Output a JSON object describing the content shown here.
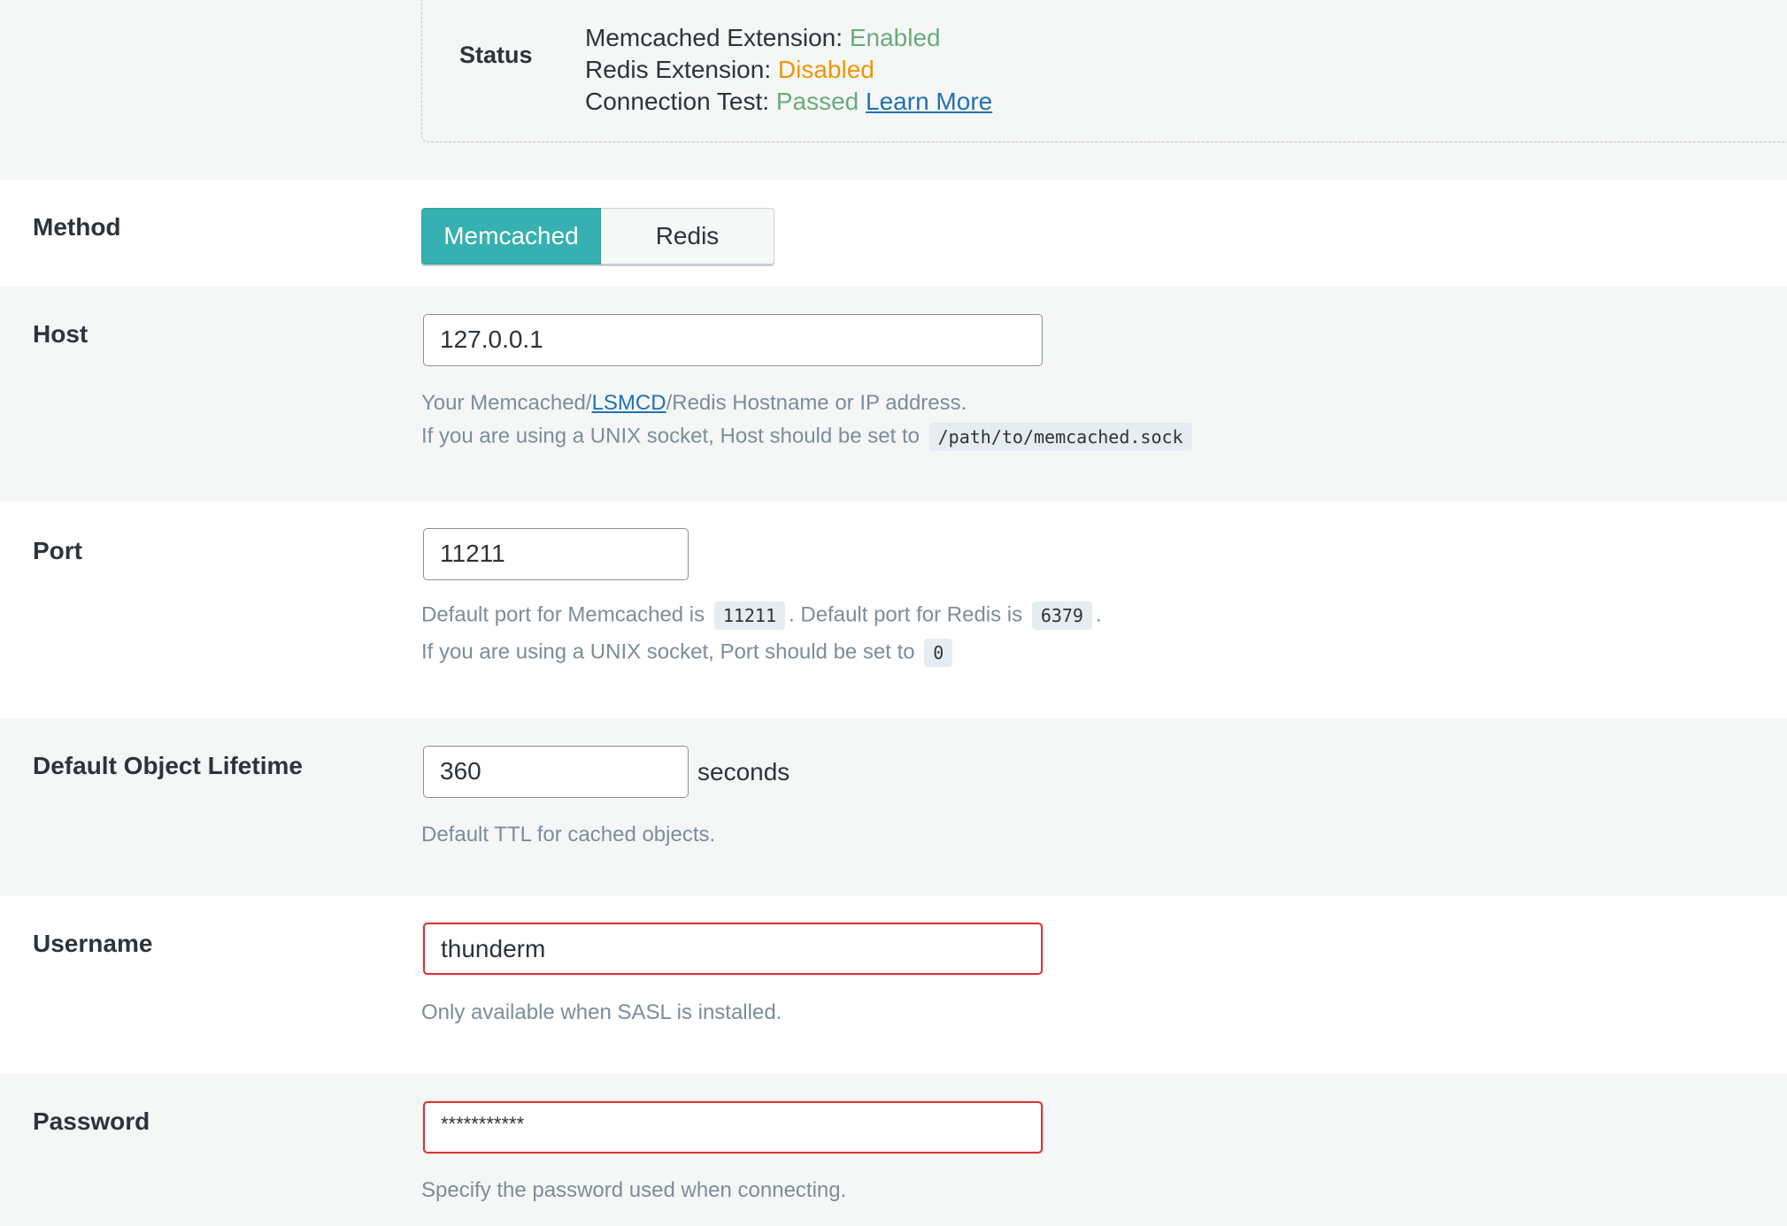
{
  "status": {
    "title": "Status",
    "memcached_label": "Memcached Extension:",
    "memcached_value": "Enabled",
    "redis_label": "Redis Extension:",
    "redis_value": "Disabled",
    "connection_label": "Connection Test:",
    "connection_value": "Passed",
    "learn_more": "Learn More",
    "colors": {
      "ok": "#6aab7b",
      "warn": "#f0940b",
      "link": "#2271b1"
    }
  },
  "method": {
    "label": "Method",
    "options": [
      "Memcached",
      "Redis"
    ],
    "selected": "Memcached",
    "accent_color": "#36b0b0"
  },
  "host": {
    "label": "Host",
    "value": "127.0.0.1",
    "desc1_pre": "Your Memcached/",
    "desc1_link": "LSMCD",
    "desc1_post": "/Redis Hostname or IP address.",
    "desc2": "If you are using a UNIX socket, Host should be set to",
    "desc2_code": "/path/to/memcached.sock"
  },
  "port": {
    "label": "Port",
    "value": "11211",
    "desc1_a": "Default port for Memcached is",
    "desc1_code1": "11211",
    "desc1_b": ". Default port for Redis is",
    "desc1_code2": "6379",
    "desc1_c": ".",
    "desc2": "If you are using a UNIX socket, Port should be set to",
    "desc2_code": "0"
  },
  "lifetime": {
    "label": "Default Object Lifetime",
    "value": "360",
    "suffix": "seconds",
    "desc": "Default TTL for cached objects."
  },
  "username": {
    "label": "Username",
    "value": "thunderm",
    "desc": "Only available when SASL is installed."
  },
  "password": {
    "label": "Password",
    "value": "***********",
    "desc": "Specify the password used when connecting."
  },
  "highlight_color": "#d63638"
}
